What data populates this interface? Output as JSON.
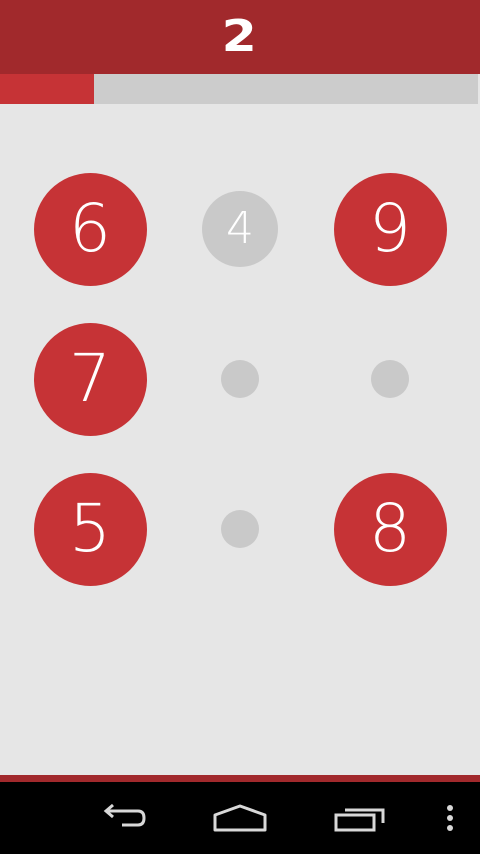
{
  "header": {
    "score": "2"
  },
  "progress": {
    "value": 0.196
  },
  "board": {
    "rows": [
      [
        {
          "state": "active",
          "number": "6"
        },
        {
          "state": "used",
          "number": "4"
        },
        {
          "state": "active",
          "number": "9"
        }
      ],
      [
        {
          "state": "active",
          "number": "7"
        },
        {
          "state": "empty",
          "number": ""
        },
        {
          "state": "empty",
          "number": ""
        }
      ],
      [
        {
          "state": "active",
          "number": "5"
        },
        {
          "state": "empty",
          "number": ""
        },
        {
          "state": "active",
          "number": "8"
        }
      ]
    ]
  },
  "navbar": {
    "buttons": [
      "back-icon",
      "home-icon",
      "recent-apps-icon",
      "overflow-menu-icon"
    ]
  },
  "colors": {
    "header": "#a1292c",
    "tile_active": "#c63336",
    "tile_inactive": "#c9c9c9",
    "background": "#e6e6e6",
    "progress_track": "#cccccc"
  }
}
